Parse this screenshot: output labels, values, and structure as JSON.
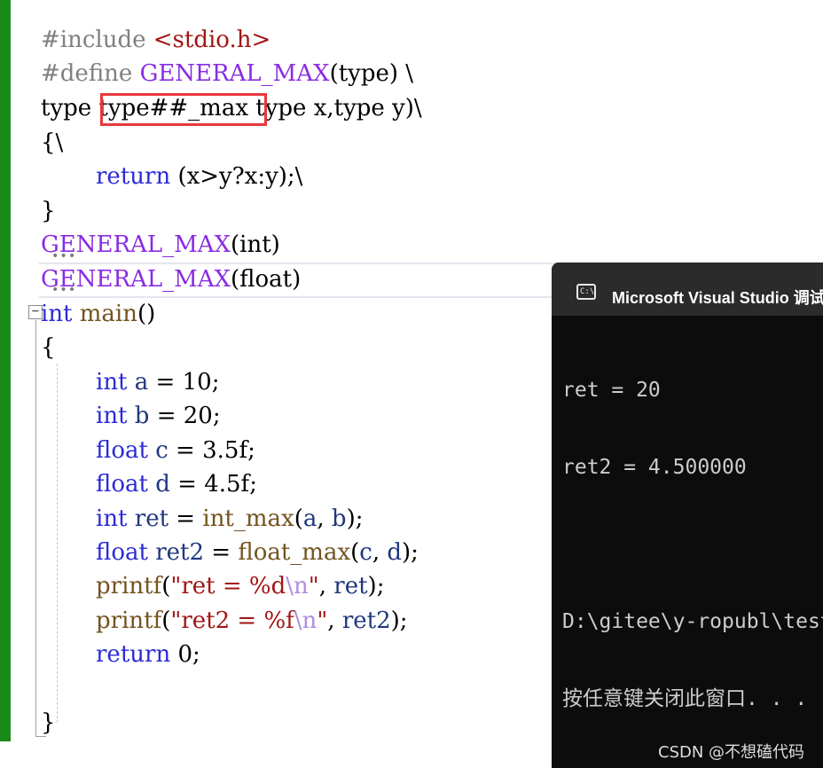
{
  "editor": {
    "lines": {
      "l1": {
        "a": "#include ",
        "b": "<stdio.h>"
      },
      "l2": {
        "a": "#define ",
        "b": "GENERAL_MAX",
        "c": "(type) \\"
      },
      "l3": {
        "a": "type",
        "b": " type##_max ",
        "c": "type x,type y)\\"
      },
      "l4": {
        "a": "{\\"
      },
      "l5": {
        "a": "return",
        "b": " (x>y?x:y);\\"
      },
      "l6": {
        "a": "}"
      },
      "l7": {
        "a": "GENERAL_MAX",
        "b": "(int)"
      },
      "l8": {
        "a": "GENERAL_MAX",
        "b": "(float)"
      },
      "l9": {
        "a": "int",
        "b": "main",
        "c": "()"
      },
      "l10": {
        "a": "{"
      },
      "l11": {
        "a": "int",
        "b": "a",
        "c": " = ",
        "d": "10",
        "e": ";"
      },
      "l12": {
        "a": "int",
        "b": "b",
        "c": " = ",
        "d": "20",
        "e": ";"
      },
      "l13": {
        "a": "float",
        "b": "c",
        "c": " = ",
        "d": "3.5f",
        "e": ";"
      },
      "l14": {
        "a": "float",
        "b": "d",
        "c": " = ",
        "d": "4.5f",
        "e": ";"
      },
      "l15": {
        "a": "int",
        "b": "ret",
        "c": " = ",
        "d": "int_max",
        "e": "(",
        "f": "a",
        "g": ", ",
        "h": "b",
        "i": ");"
      },
      "l16": {
        "a": "float",
        "b": "ret2",
        "c": " = ",
        "d": "float_max",
        "e": "(",
        "f": "c",
        "g": ", ",
        "h": "d",
        "i": ");"
      },
      "l17": {
        "a": "printf",
        "b": "(",
        "c": "\"ret = %d",
        "d": "\\n",
        "e": "\"",
        "f": ", ",
        "g": "ret",
        "h": ");"
      },
      "l18": {
        "a": "printf",
        "b": "(",
        "c": "\"ret2 = %f",
        "d": "\\n",
        "e": "\"",
        "f": ", ",
        "g": "ret2",
        "h": ");"
      },
      "l19": {
        "a": "return",
        "b": "0",
        "c": ";"
      },
      "l20": {
        "a": "}"
      }
    },
    "fold_toggle": "−",
    "dots": "•••"
  },
  "console": {
    "title": "Microsoft Visual Studio 调试控制台",
    "icon": "console-icon",
    "output": [
      "ret = 20",
      "ret2 = 4.500000",
      "",
      "D:\\gitee\\y-ropubl\\test",
      "按任意键关闭此窗口. . ."
    ]
  },
  "watermark": "CSDN @不想磕代码",
  "colors": {
    "keyword": "#2b2bd8",
    "macro": "#8a2be2",
    "function": "#74531f",
    "variable": "#1f377f",
    "string": "#a31515",
    "highlight_box": "#e8383d",
    "gutter": "#1a8a1a",
    "console_bg": "#0c0c0c"
  }
}
